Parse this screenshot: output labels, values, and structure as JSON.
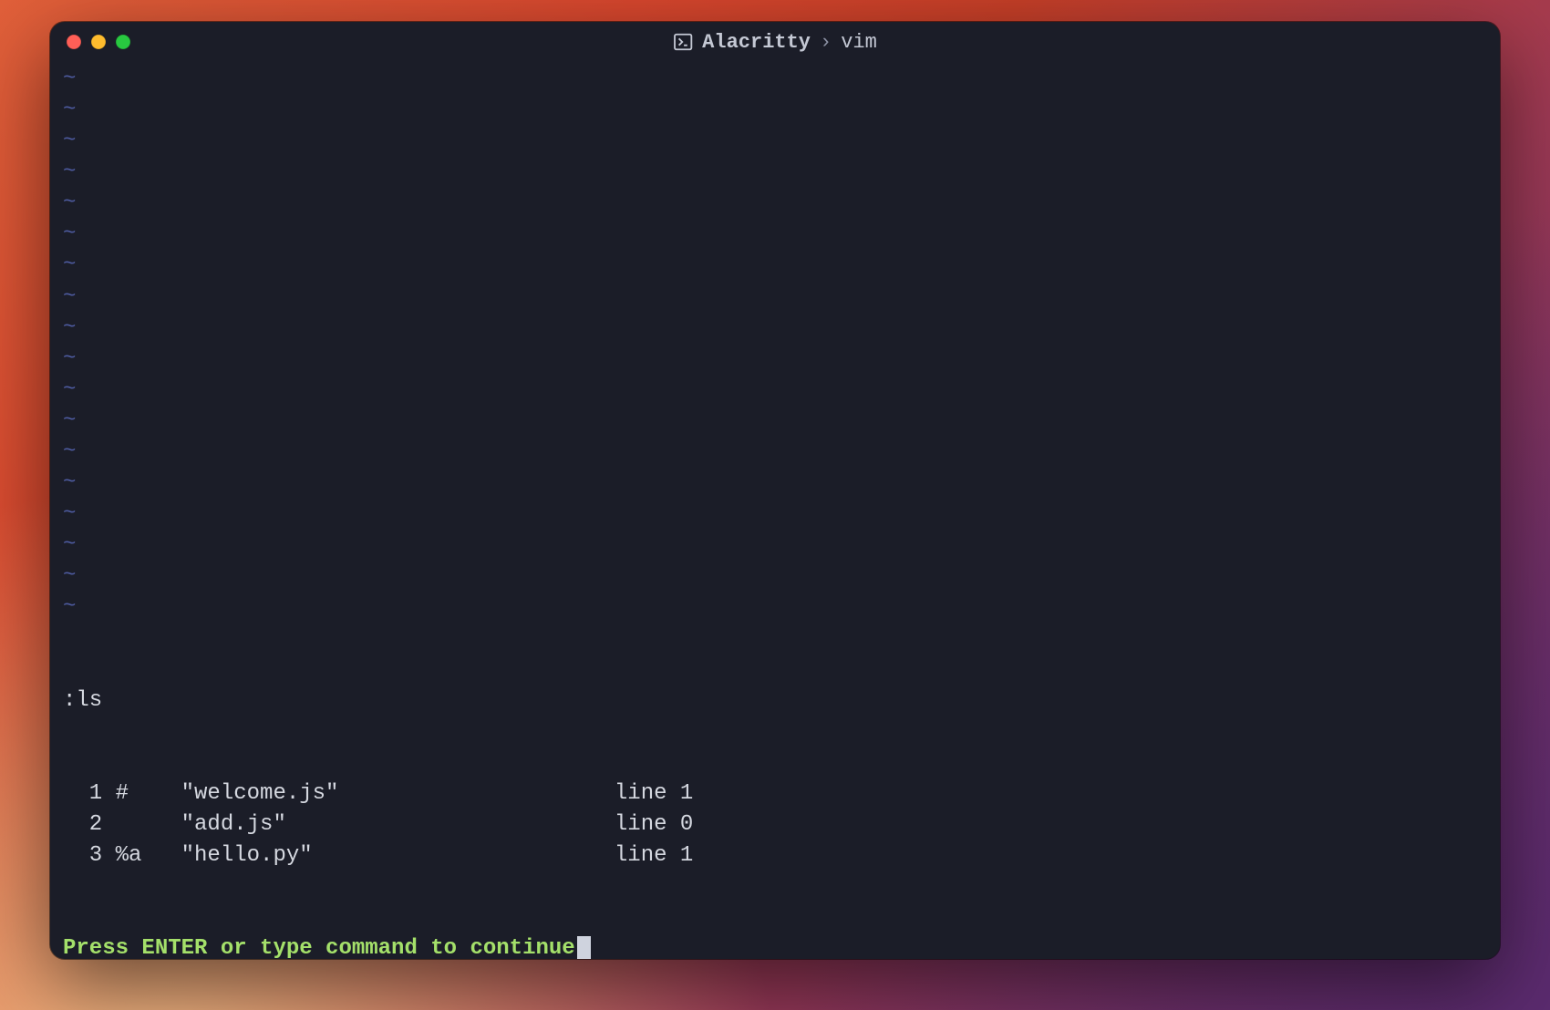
{
  "title": {
    "app": "Alacritty",
    "separator": "›",
    "sub": "vim"
  },
  "tilde_char": "~",
  "tilde_rows": 18,
  "command_line": ":ls",
  "buffers": [
    {
      "num": "1",
      "flags": "#",
      "name": "\"welcome.js\"",
      "pos": "line 1"
    },
    {
      "num": "2",
      "flags": "",
      "name": "\"add.js\"",
      "pos": "line 0"
    },
    {
      "num": "3",
      "flags": "%a",
      "name": "\"hello.py\"",
      "pos": "line 1"
    }
  ],
  "prompt": "Press ENTER or type command to continue"
}
